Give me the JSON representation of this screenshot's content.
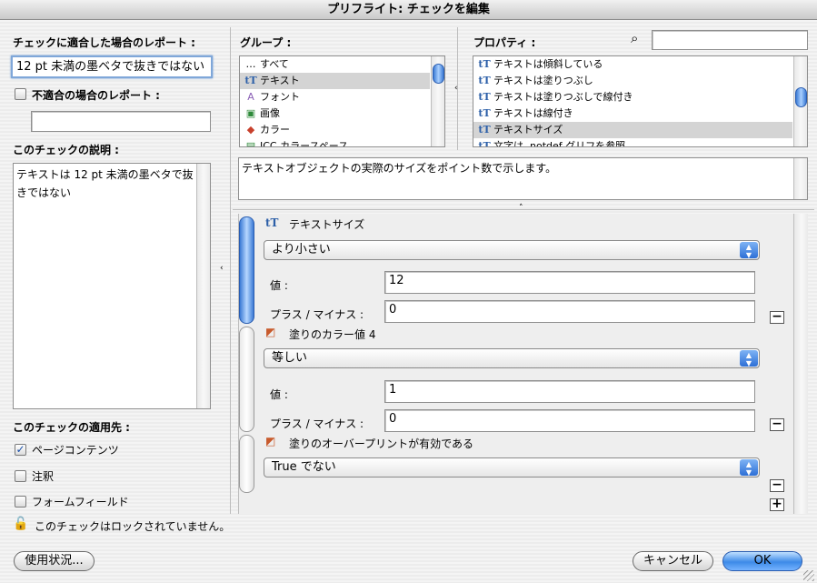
{
  "window": {
    "title": "プリフライト: チェックを編集"
  },
  "left": {
    "report_match_label": "チェックに適合した場合のレポート :",
    "report_match_value": "12 pt 未満の墨ベタで抜きではない",
    "report_nomatch_label": "不適合の場合のレポート :",
    "report_nomatch_value": "",
    "description_label": "このチェックの説明 :",
    "description_text": "テキストは 12 pt 未満の墨ベタで抜きではない",
    "applies_label": "このチェックの適用先 :",
    "applies_options": [
      {
        "label": "ページコンテンツ",
        "checked": true,
        "mark": "✓"
      },
      {
        "label": "注釈",
        "checked": false,
        "mark": ""
      },
      {
        "label": "フォームフィールド",
        "checked": false,
        "mark": ""
      }
    ],
    "lock_text": "このチェックはロックされていません。"
  },
  "groups": {
    "label": "グループ :",
    "items": [
      {
        "icon": "dots-icon",
        "glyph": "…",
        "label": "すべて",
        "selected": false
      },
      {
        "icon": "text-icon",
        "glyph": "tT",
        "label": "テキスト",
        "selected": true
      },
      {
        "icon": "font-icon",
        "glyph": "A",
        "label": "フォント",
        "selected": false
      },
      {
        "icon": "image-icon",
        "glyph": "▣",
        "label": "画像",
        "selected": false
      },
      {
        "icon": "color-icon",
        "glyph": "◆",
        "label": "カラー",
        "selected": false
      },
      {
        "icon": "icc-icon",
        "glyph": "▤",
        "label": "ICC カラースペース",
        "selected": false
      }
    ]
  },
  "properties": {
    "label": "プロパティ :",
    "search_value": "",
    "items": [
      {
        "icon": "text-icon",
        "glyph": "tT",
        "label": "テキストは傾斜している",
        "selected": false
      },
      {
        "icon": "text-icon",
        "glyph": "tT",
        "label": "テキストは塗りつぶし",
        "selected": false
      },
      {
        "icon": "text-icon",
        "glyph": "tT",
        "label": "テキストは塗りつぶしで線付き",
        "selected": false
      },
      {
        "icon": "text-icon",
        "glyph": "tT",
        "label": "テキストは線付き",
        "selected": false
      },
      {
        "icon": "text-icon",
        "glyph": "tT",
        "label": "テキストサイズ",
        "selected": true
      },
      {
        "icon": "text-icon",
        "glyph": "tT",
        "label": "文字は .notdef グリフを参照",
        "selected": false
      }
    ],
    "description": "テキストオブジェクトの実際のサイズをポイント数で示します。"
  },
  "conditions": [
    {
      "title": "テキストサイズ",
      "icon": "text-size-icon",
      "glyph": "tT",
      "operator": "より小さい",
      "value_label": "値 :",
      "value": "12",
      "tolerance_label": "プラス / マイナス :",
      "tolerance": "0"
    },
    {
      "title": "塗りのカラー値 4",
      "icon": "fill-color-icon",
      "glyph": "◩",
      "operator": "等しい",
      "value_label": "値 :",
      "value": "1",
      "tolerance_label": "プラス / マイナス :",
      "tolerance": "0"
    },
    {
      "title": "塗りのオーバープリントが有効である",
      "icon": "overprint-icon",
      "glyph": "◩",
      "operator": "True でない"
    }
  ],
  "buttons": {
    "usage": "使用状況...",
    "cancel": "キャンセル",
    "ok": "OK",
    "minus": "−",
    "plus": "+"
  },
  "icons": {
    "search": "⌕",
    "lock": "🔓",
    "popup_arrows": "▲▼"
  },
  "colors": {
    "accent": "#3d8ae8",
    "selection": "#d4d4d4"
  }
}
